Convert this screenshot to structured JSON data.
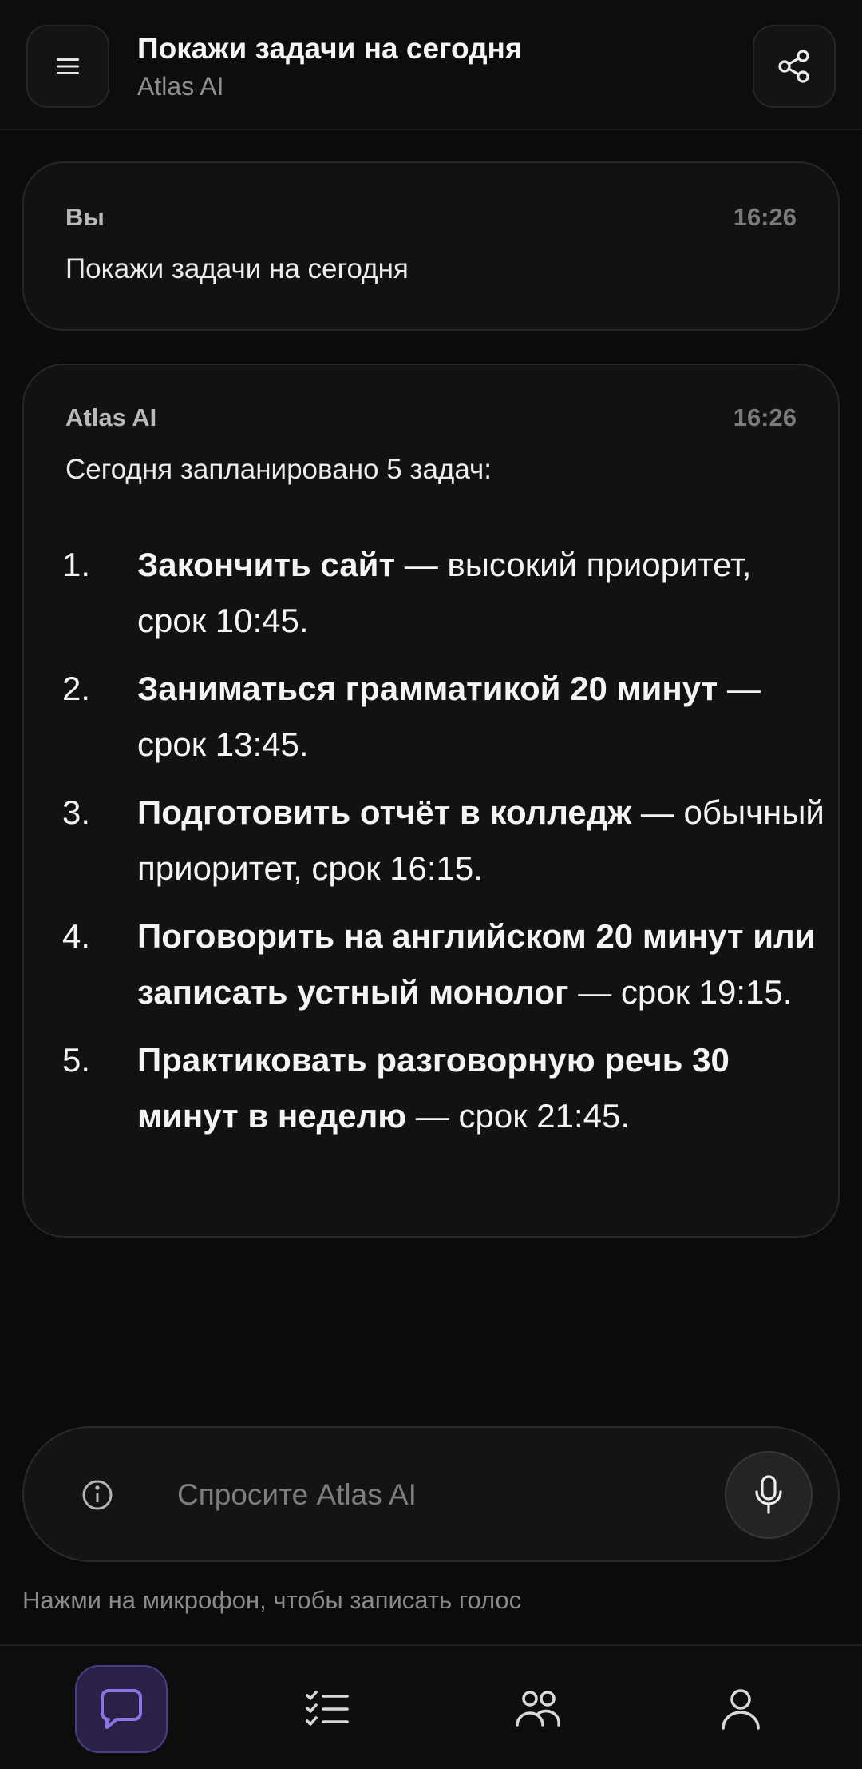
{
  "header": {
    "title": "Покажи задачи на сегодня",
    "subtitle": "Atlas AI",
    "icons": {
      "menu": "hamburger-menu-icon",
      "share": "share-icon"
    }
  },
  "messages": [
    {
      "author": "Вы",
      "time": "16:26",
      "text": "Покажи задачи на сегодня"
    },
    {
      "author": "Atlas AI",
      "time": "16:26",
      "intro": "Сегодня запланировано 5 задач:",
      "tasks": [
        {
          "num": "1.",
          "name": "Закончить сайт",
          "detail": " — высокий приоритет, срок 10:45."
        },
        {
          "num": "2.",
          "name": "Заниматься грамматикой 20 минут",
          "detail": " — срок 13:45."
        },
        {
          "num": "3.",
          "name": "Подготовить отчёт в колледж",
          "detail": " — обычный приоритет, срок 16:15."
        },
        {
          "num": "4.",
          "name": "Поговорить на английском 20 минут или записать устный монолог",
          "detail": " — срок 19:15."
        },
        {
          "num": "5.",
          "name": "Практиковать разговорную речь 30 минут в неделю",
          "detail": " — срок 21:45."
        }
      ]
    }
  ],
  "input": {
    "placeholder": "Спросите Atlas AI",
    "value": "",
    "hint": "Нажми на микрофон, чтобы записать голос",
    "icons": {
      "info": "info-icon",
      "mic": "microphone-icon"
    }
  },
  "nav": {
    "active": "chat",
    "items": [
      "chat",
      "tasks",
      "people",
      "profile"
    ]
  },
  "colors": {
    "background": "#0b0b0b",
    "card": "#121212",
    "accent": "#8b74e6",
    "accent_bg": "#2a2146"
  }
}
